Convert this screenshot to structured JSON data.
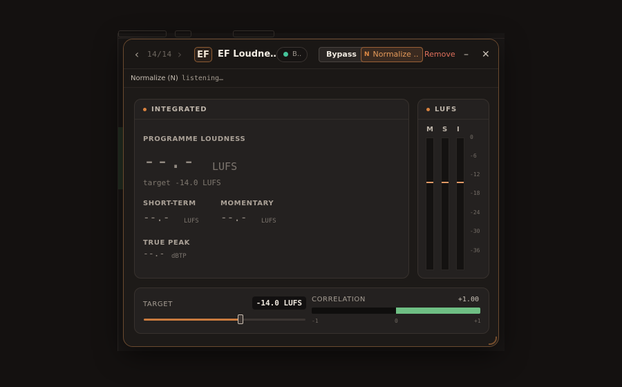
{
  "window": {
    "prev_icon": "chevron-left-icon",
    "next_icon": "chevron-right-icon",
    "counter": "14/14",
    "logo_text": "EF",
    "plugin_name": "EF Loudne…",
    "status_pill_label": "B..",
    "status_pill_color": "#45c39a",
    "bypass_label": "Bypass",
    "normalize_key": "N",
    "normalize_label": "Normalize ..",
    "remove_label": "Remove",
    "minimize_glyph": "–",
    "close_glyph": "✕"
  },
  "statusbar": {
    "label": "Normalize (N)",
    "value": "listening…"
  },
  "integrated": {
    "title": "INTEGRATED",
    "programme_label": "PROGRAMME LOUDNESS",
    "programme_value": "--.-",
    "programme_unit": "LUFS",
    "target_text": "target -14.0 LUFS",
    "short_term_label": "SHORT-TERM",
    "short_term_value": "--.-",
    "short_term_unit": "LUFS",
    "momentary_label": "MOMENTARY",
    "momentary_value": "--.-",
    "momentary_unit": "LUFS",
    "true_peak_label": "TRUE PEAK",
    "true_peak_value": "--.-",
    "true_peak_unit": "dBTP"
  },
  "meters": {
    "title": "LUFS",
    "columns": [
      "M",
      "S",
      "I"
    ],
    "scale": [
      "0",
      "-6",
      "-12",
      "-18",
      "-24",
      "-30",
      "-36"
    ],
    "target_marker_lufs": -14,
    "scale_min": -42,
    "scale_max": 0,
    "marker_color": "#e39a66"
  },
  "target": {
    "label": "TARGET",
    "value_text": "-14.0 LUFS",
    "slider_fraction": 0.6
  },
  "correlation": {
    "label": "CORRELATION",
    "value_text": "+1.00",
    "value": 1.0,
    "min_label": "-1",
    "mid_label": "0",
    "max_label": "+1",
    "color": "#6fbf84"
  }
}
